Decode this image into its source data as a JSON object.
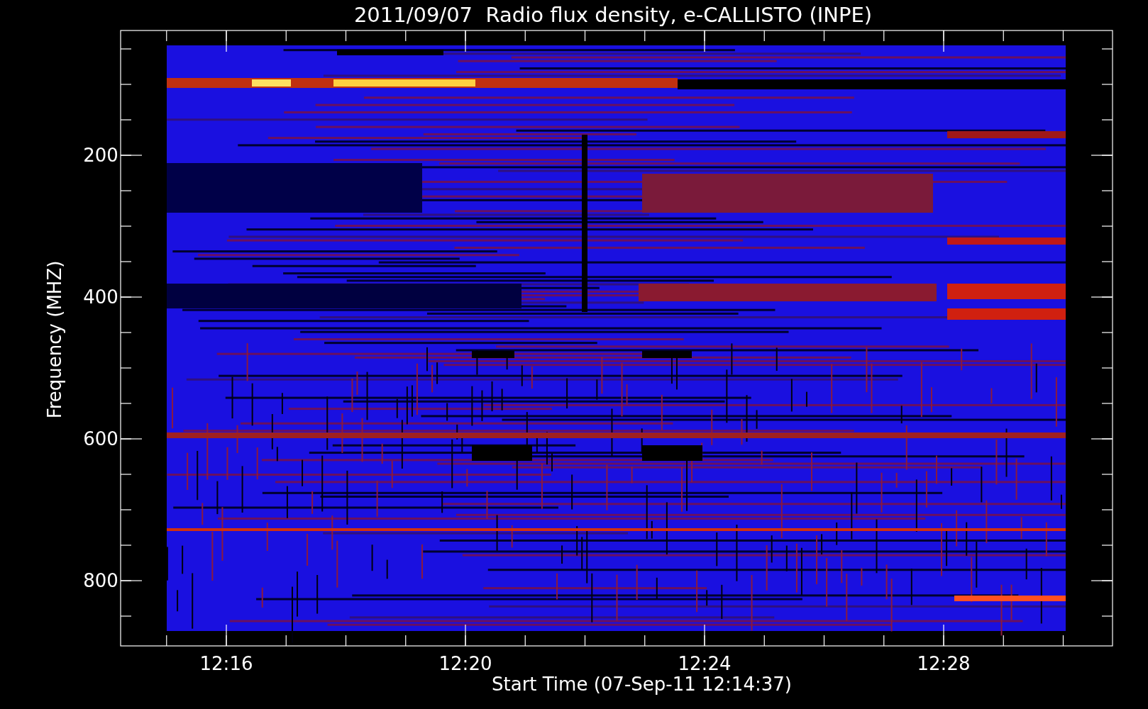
{
  "title": "2011/09/07  Radio flux density, e-CALLISTO (INPE)",
  "ylabel": "Frequency (MHZ)",
  "xlabel": "Start Time (07-Sep-11 12:14:37)",
  "yticks": [
    "200",
    "400",
    "600",
    "800"
  ],
  "xticks": [
    "12:16",
    "12:20",
    "12:24",
    "12:28"
  ]
}
